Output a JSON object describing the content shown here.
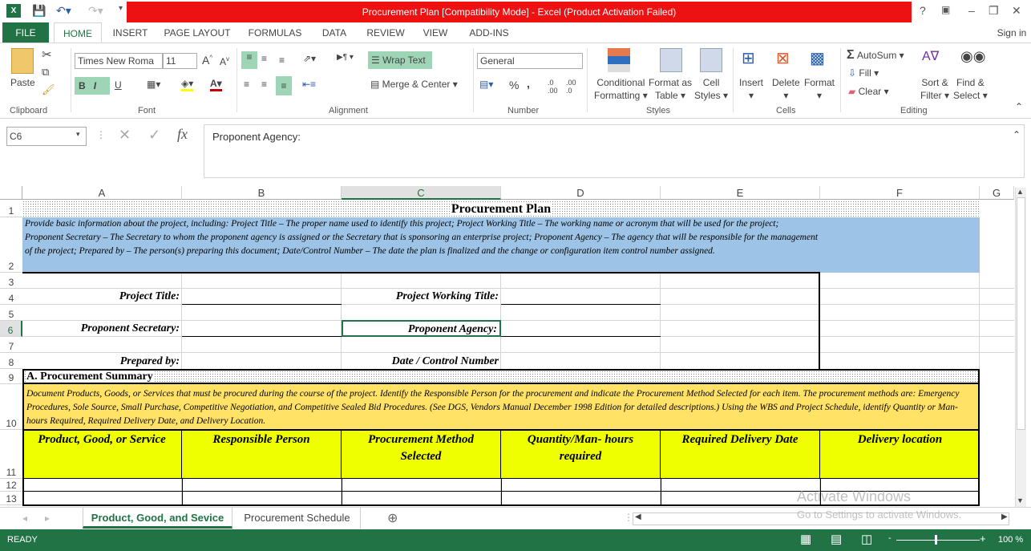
{
  "titlebar": {
    "title": "Procurement Plan  [Compatibility Mode] -  Excel (Product Activation Failed)",
    "help": "?",
    "sign_in": "Sign in"
  },
  "menu_tabs": [
    "FILE",
    "HOME",
    "INSERT",
    "PAGE LAYOUT",
    "FORMULAS",
    "DATA",
    "REVIEW",
    "VIEW",
    "ADD-INS"
  ],
  "ribbon": {
    "clipboard": {
      "paste": "Paste",
      "group": "Clipboard"
    },
    "font": {
      "name": "Times New Roma",
      "size": "11",
      "bold": "B",
      "italic": "I",
      "underline": "U",
      "group": "Font"
    },
    "alignment": {
      "wrap_text": "Wrap Text",
      "merge_center": "Merge & Center",
      "group": "Alignment"
    },
    "number": {
      "format": "General",
      "percent": "%",
      "comma": ",",
      "group": "Number"
    },
    "styles": {
      "conditional": "Conditional",
      "conditional2": "Formatting",
      "format_as": "Format as",
      "format_as2": "Table",
      "cell_styles": "Cell",
      "cell_styles2": "Styles",
      "group": "Styles"
    },
    "cells": {
      "insert": "Insert",
      "delete": "Delete",
      "format": "Format",
      "group": "Cells"
    },
    "editing": {
      "autosum": "AutoSum",
      "fill": "Fill",
      "clear": "Clear",
      "sort": "Sort &",
      "sort2": "Filter",
      "find": "Find &",
      "find2": "Select",
      "group": "Editing"
    }
  },
  "formula_bar": {
    "name_box": "C6",
    "fx": "fx",
    "content": "Proponent Agency:"
  },
  "columns": [
    "A",
    "B",
    "C",
    "D",
    "E",
    "F",
    "G"
  ],
  "rows": [
    "1",
    "2",
    "3",
    "4",
    "5",
    "6",
    "7",
    "8",
    "9",
    "10",
    "11",
    "12",
    "13"
  ],
  "sheet": {
    "title": "Procurement Plan",
    "intro": "Provide basic information about the project, including: Project Title – The proper name used to identify this project; Project Working Title – The working name or acronym that will be used for the project; Proponent Secretary – The Secretary to whom the proponent agency is assigned or the Secretary that is sponsoring an enterprise project; Proponent Agency – The agency that will be responsible for the management of the project; Prepared by – The person(s) preparing this document; Date/Control Number – The date the plan is finalized and the change or configuration item control number assigned.",
    "project_title": "Project Title:",
    "project_working_title": "Project Working Title:",
    "proponent_secretary": "Proponent Secretary:",
    "proponent_agency": "Proponent Agency:",
    "prepared_by": "Prepared by:",
    "date_control": "Date / Control Number",
    "section_a": "A.  Procurement Summary",
    "section_a_desc": "Document Products, Goods, or Services that must be procured during the course of the project.  Identify the Responsible Person for the procurement and indicate the Procurement Method Selected for each item.  The procurement methods are: Emergency Procedures, Sole Source, Small Purchase, Competitive Negotiation, and Competitive Sealed Bid Procedures.  (See DGS, Vendors Manual December 1998 Edition for detailed descriptions.)  Using the WBS and Project Schedule, identify Quantity or Man-hours Required, Required Delivery Date, and Delivery Location.",
    "table_headers": [
      "Product, Good, or Service",
      "Responsible Person",
      "Procurement Method Selected",
      "Quantity/Man- hours required",
      "Required Delivery Date",
      "Delivery location"
    ]
  },
  "sheet_tabs": [
    "Product, Good, and Sevice",
    "Procurement Schedule"
  ],
  "watermark": {
    "line1": "Activate Windows",
    "line2": "Go to Settings to activate Windows."
  },
  "status": {
    "ready": "READY",
    "zoom": "100 %"
  },
  "colors": {
    "title_red": "#ee1111",
    "excel_green": "#217346",
    "blue_fill": "#9dc3e6",
    "yellow_desc": "#ffe266",
    "yellow_header": "#f0ff00"
  }
}
